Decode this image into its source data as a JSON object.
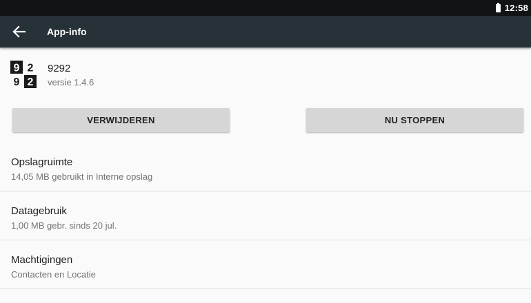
{
  "status_bar": {
    "time": "12:58",
    "battery_icon": "battery-icon"
  },
  "app_bar": {
    "title": "App-info",
    "back_icon": "arrow-back-icon"
  },
  "app": {
    "name": "9292",
    "version": "versie 1.4.6",
    "logo": {
      "digits": [
        "9",
        "2",
        "9",
        "2"
      ]
    }
  },
  "buttons": {
    "uninstall": "VERWIJDEREN",
    "force_stop": "NU STOPPEN"
  },
  "rows": [
    {
      "title": "Opslagruimte",
      "subtitle": "14,05 MB gebruikt in Interne opslag"
    },
    {
      "title": "Datagebruik",
      "subtitle": "1,00 MB gebr. sinds 20 jul."
    },
    {
      "title": "Machtigingen",
      "subtitle": "Contacten en Locatie"
    }
  ],
  "colors": {
    "status_bar": "#111315",
    "app_bar": "#263238",
    "background": "#fafafa",
    "button": "#d6d6d6",
    "divider": "#dcdcdc",
    "primary_text": "#212121",
    "secondary_text": "#737373"
  }
}
